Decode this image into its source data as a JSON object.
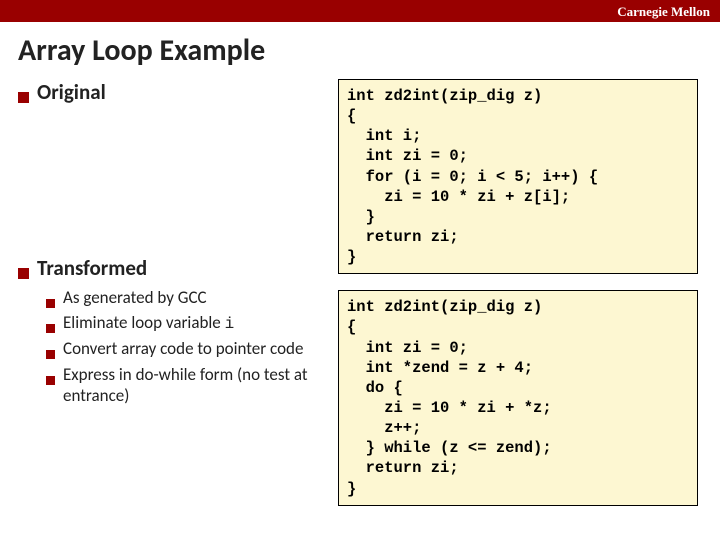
{
  "brand": "Carnegie Mellon",
  "title": "Array Loop Example",
  "left": {
    "section1": {
      "heading": "Original"
    },
    "section2": {
      "heading": "Transformed",
      "items": [
        "As generated by GCC",
        "Eliminate loop variable ",
        "Convert array code to pointer code",
        "Express in do-while form (no test at entrance)"
      ],
      "codevar_i": "i"
    }
  },
  "code1": "int zd2int(zip_dig z)\n{\n  int i;\n  int zi = 0;\n  for (i = 0; i < 5; i++) {\n    zi = 10 * zi + z[i];\n  }\n  return zi;\n}",
  "code2": "int zd2int(zip_dig z)\n{\n  int zi = 0;\n  int *zend = z + 4;\n  do {\n    zi = 10 * zi + *z;\n    z++;\n  } while (z <= zend);\n  return zi;\n}"
}
